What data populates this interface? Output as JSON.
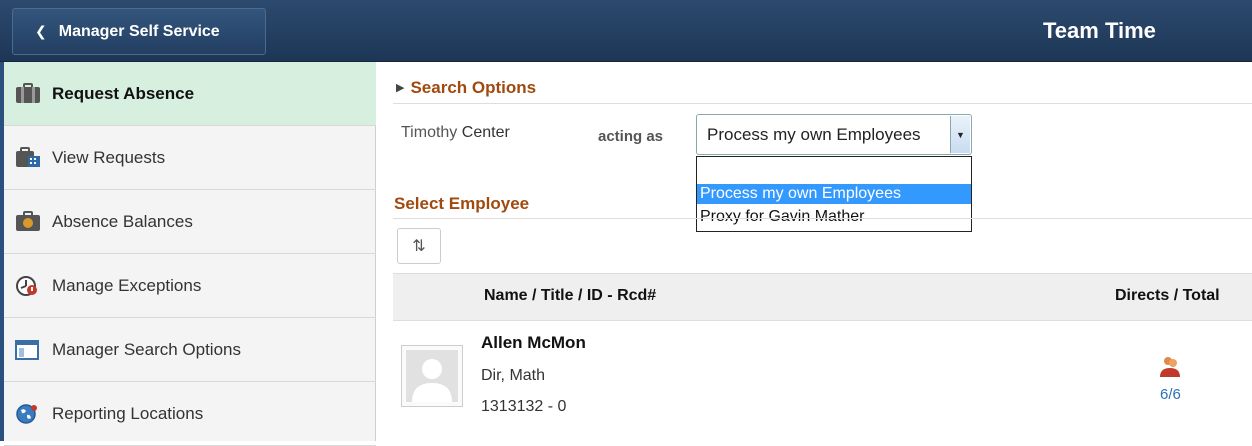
{
  "header": {
    "back_label": "Manager Self Service",
    "title": "Team Time"
  },
  "sidebar": {
    "items": [
      {
        "label": "Request Absence",
        "icon": "briefcase-icon",
        "active": true
      },
      {
        "label": "View Requests",
        "icon": "calendar-briefcase-icon",
        "active": false
      },
      {
        "label": "Absence Balances",
        "icon": "balance-briefcase-icon",
        "active": false
      },
      {
        "label": "Manage Exceptions",
        "icon": "clock-alert-icon",
        "active": false
      },
      {
        "label": "Manager Search Options",
        "icon": "window-options-icon",
        "active": false
      },
      {
        "label": "Reporting Locations",
        "icon": "globe-icon",
        "active": false
      }
    ]
  },
  "search": {
    "section_label": "Search Options",
    "user_first": "Timothy",
    "user_last": "Center",
    "acting_label": "acting as",
    "selected_value": "Process my own Employees",
    "options": [
      "",
      "Process my own Employees",
      "Proxy for Gavin Mather"
    ]
  },
  "employees": {
    "section_label": "Select Employee",
    "col_name": "Name / Title / ID - Rcd#",
    "col_directs": "Directs / Total",
    "rows": [
      {
        "name": "Allen McMon",
        "title": "Dir, Math",
        "id": "1313132 - 0",
        "directs": "6/6"
      }
    ]
  },
  "colors": {
    "header_bg": "#1d3656",
    "active_nav": "#d6efdf",
    "section_title": "#a04a10",
    "dropdown_highlight": "#3399ff",
    "link_blue": "#2a6fb8"
  }
}
